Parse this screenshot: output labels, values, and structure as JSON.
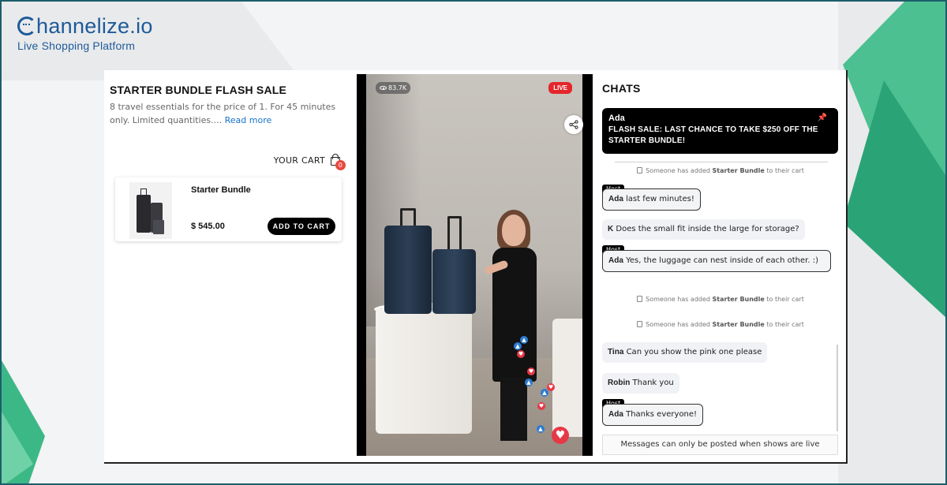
{
  "brand": {
    "name": "hannelize.io",
    "tagline": "Live Shopping Platform"
  },
  "product": {
    "title": "STARTER BUNDLE FLASH SALE",
    "description": "8 travel essentials for the price of 1. For 45 minutes only. Limited quantities....",
    "read_more": "Read more",
    "cart_label": "YOUR CART",
    "cart_count": "0",
    "item_name": "Starter Bundle",
    "item_price": "$ 545.00",
    "add_to_cart": "ADD TO CART"
  },
  "video": {
    "views": "83.7K",
    "live_label": "LIVE"
  },
  "chats": {
    "title": "CHATS",
    "pinned": {
      "author": "Ada",
      "text": "FLASH SALE: LAST CHANCE TO TAKE $250 OFF THE STARTER BUNDLE!"
    },
    "system_prefix": "Someone has added",
    "system_product": "Starter Bundle",
    "system_suffix": "to their cart",
    "host_label": "Host",
    "messages": [
      {
        "author": "Ada",
        "text": "last few minutes!"
      },
      {
        "author": "K",
        "text": "Does the small fit inside the large for storage?"
      },
      {
        "author": "Ada",
        "text": "Yes, the luggage can nest inside of each other. :)"
      },
      {
        "author": "Tina",
        "text": "Can you show the pink one please"
      },
      {
        "author": "Robin",
        "text": "Thank you"
      },
      {
        "author": "Ada",
        "text": "Thanks everyone!"
      }
    ],
    "footer": "Messages can only be posted when shows are live"
  },
  "colors": {
    "brand_blue": "#1d5a9b",
    "accent_green": "#3cb886",
    "live_red": "#e4262c",
    "like_blue": "#2d7ccf"
  }
}
